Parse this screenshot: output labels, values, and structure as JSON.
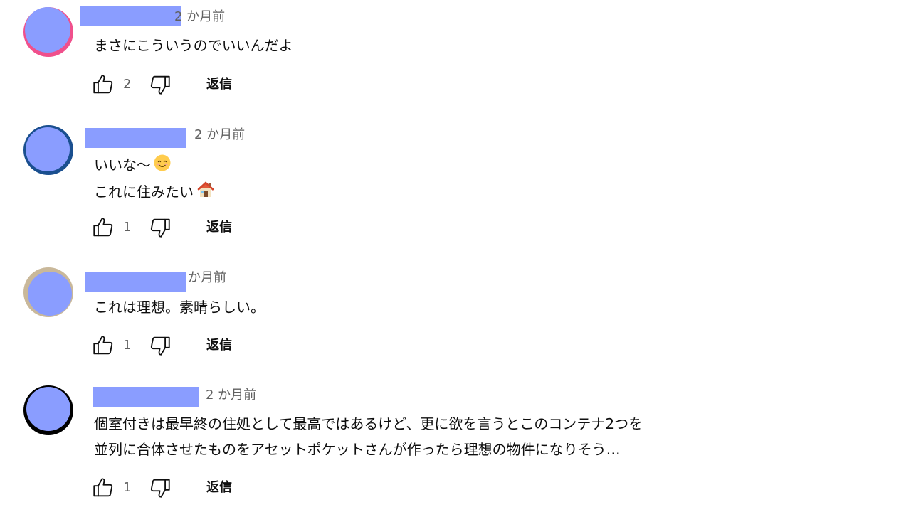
{
  "comments": [
    {
      "time": "2 か月前",
      "lines": [
        "まさにこういうのでいいんだよ"
      ],
      "likes": "2",
      "reply_label": "返信",
      "avatar_ring_color": "#f0508c"
    },
    {
      "time": "2 か月前",
      "lines": [
        "いいな～",
        "これに住みたい"
      ],
      "likes": "1",
      "reply_label": "返信",
      "avatar_ring_color": "#1a4f8f",
      "emojis": [
        "smiling-face-emoji",
        "house-emoji"
      ]
    },
    {
      "time": "か月前",
      "lines": [
        "これは理想。素晴らしい。"
      ],
      "likes": "1",
      "reply_label": "返信",
      "avatar_ring_color": "#c9b89a"
    },
    {
      "time": "2 か月前",
      "lines": [
        "個室付きは最早終の住処として最高ではあるけど、更に欲を言うとこのコンテナ2つを",
        "並列に合体させたものをアセットポケットさんが作ったら理想の物件になりそう…"
      ],
      "likes": "1",
      "reply_label": "返信",
      "avatar_ring_color": "#000000"
    }
  ],
  "icons": {
    "like": "thumbs-up-icon",
    "dislike": "thumbs-down-icon"
  }
}
